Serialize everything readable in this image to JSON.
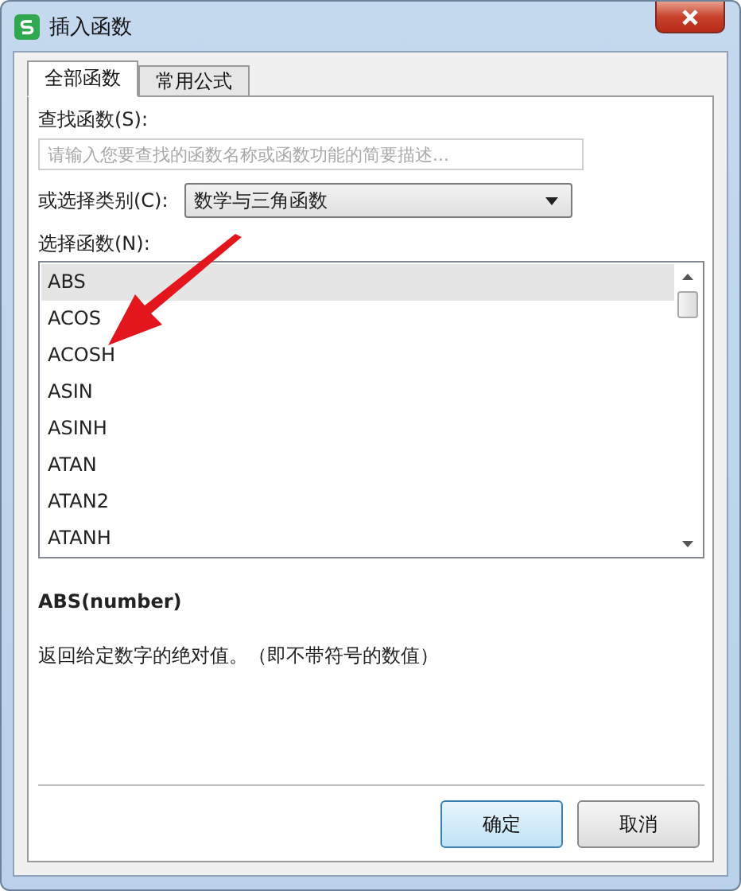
{
  "window": {
    "title": "插入函数"
  },
  "tabs": [
    {
      "label": "全部函数",
      "selected": true
    },
    {
      "label": "常用公式",
      "selected": false
    }
  ],
  "search": {
    "label": "查找函数(S):",
    "placeholder": "请输入您要查找的函数名称或函数功能的简要描述..."
  },
  "category": {
    "label": "或选择类别(C):",
    "value": "数学与三角函数"
  },
  "functions": {
    "label": "选择函数(N):",
    "items": [
      {
        "name": "ABS",
        "selected": true
      },
      {
        "name": "ACOS",
        "selected": false
      },
      {
        "name": "ACOSH",
        "selected": false
      },
      {
        "name": "ASIN",
        "selected": false
      },
      {
        "name": "ASINH",
        "selected": false
      },
      {
        "name": "ATAN",
        "selected": false
      },
      {
        "name": "ATAN2",
        "selected": false
      },
      {
        "name": "ATANH",
        "selected": false
      }
    ]
  },
  "signature": "ABS(number)",
  "description": "返回给定数字的绝对值。（即不带符号的数值）",
  "buttons": [
    {
      "label": "确定",
      "kind": "primary"
    },
    {
      "label": "取消",
      "kind": "normal"
    }
  ]
}
